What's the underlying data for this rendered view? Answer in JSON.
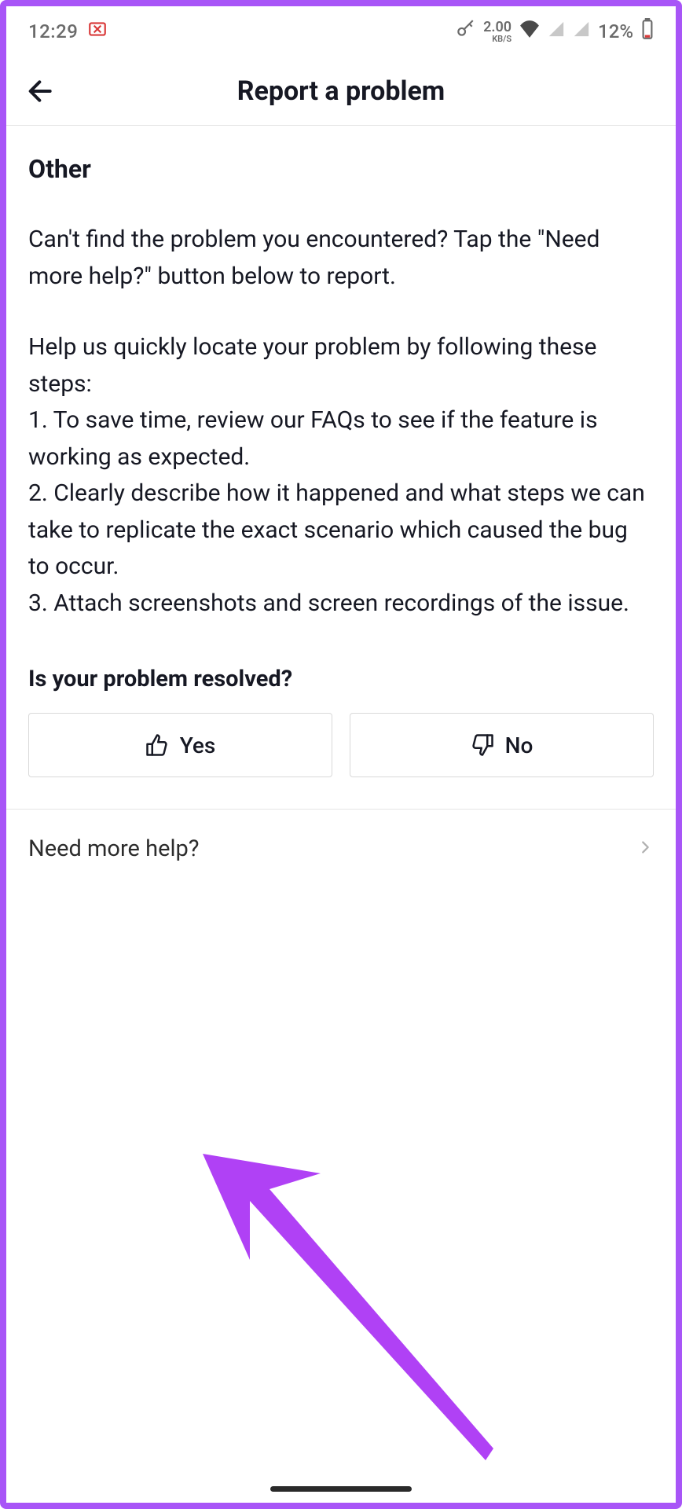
{
  "status": {
    "time": "12:29",
    "speed_val": "2.00",
    "speed_unit": "KB/S",
    "battery_pct": "12%"
  },
  "header": {
    "title": "Report a problem"
  },
  "section": {
    "title": "Other",
    "para1": "Can't find the problem you encountered? Tap the \"Need more help?\" button below to report.",
    "para2": "Help us quickly locate your problem by following these steps:\n1. To save time, review our FAQs to see if the feature is working as expected.\n2. Clearly describe how it happened and what steps we can take to replicate the exact scenario which caused the bug to occur.\n3. Attach screenshots and screen recordings of the issue."
  },
  "resolved": {
    "question": "Is your problem resolved?",
    "yes": "Yes",
    "no": "No"
  },
  "more_help": {
    "label": "Need more help?"
  }
}
